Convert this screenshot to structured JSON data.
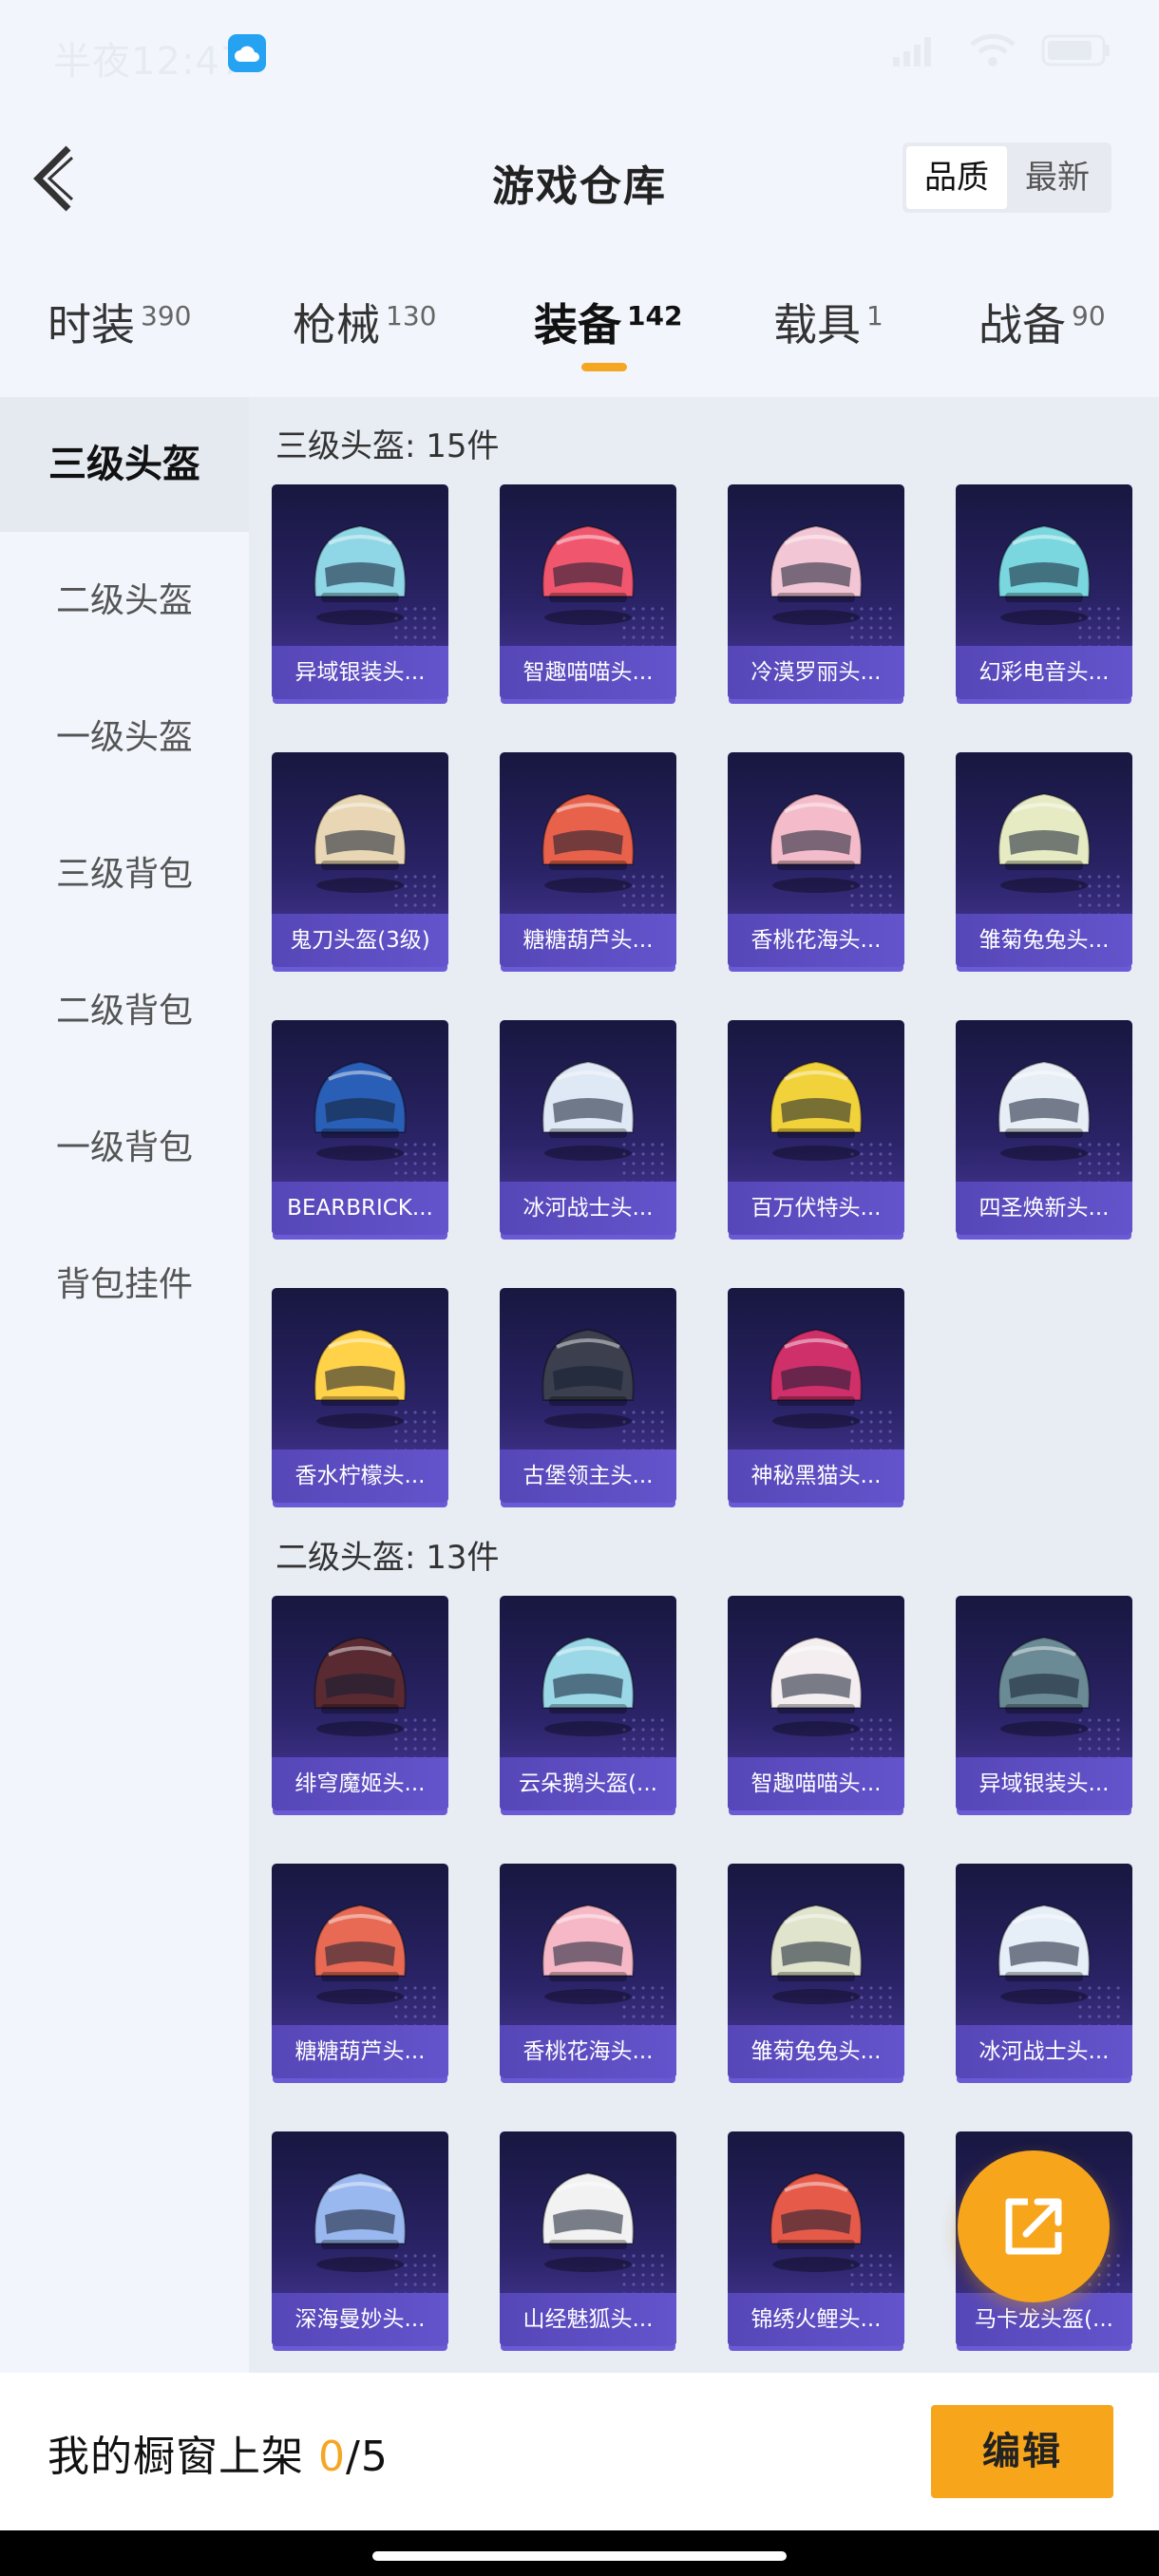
{
  "status_bar": {
    "time": "半夜12:47"
  },
  "header": {
    "title": "游戏仓库",
    "sort_options": [
      "品质",
      "最新"
    ]
  },
  "tabs": [
    {
      "label": "时装",
      "count": "390"
    },
    {
      "label": "枪械",
      "count": "130"
    },
    {
      "label": "装备",
      "count": "142"
    },
    {
      "label": "载具",
      "count": "1"
    },
    {
      "label": "战备",
      "count": "90"
    }
  ],
  "sidebar": [
    "三级头盔",
    "二级头盔",
    "一级头盔",
    "三级背包",
    "二级背包",
    "一级背包",
    "背包挂件"
  ],
  "sections": [
    {
      "title": "三级头盔: 15件",
      "items": [
        {
          "name": "异域银装头...",
          "color": "#8fd6e6"
        },
        {
          "name": "智趣喵喵头...",
          "color": "#f0566e"
        },
        {
          "name": "冷漠罗丽头...",
          "color": "#f3c6d6"
        },
        {
          "name": "幻彩电音头...",
          "color": "#7ad7e0"
        },
        {
          "name": "鬼刀头盔(3级)",
          "color": "#e8d6b4"
        },
        {
          "name": "糖糖葫芦头...",
          "color": "#e8614a"
        },
        {
          "name": "香桃花海头...",
          "color": "#f4bccb"
        },
        {
          "name": "雏菊兔兔头...",
          "color": "#e6ebc4"
        },
        {
          "name": "BEARBRICK...",
          "color": "#2a5fb8"
        },
        {
          "name": "冰河战士头...",
          "color": "#dfe8f5"
        },
        {
          "name": "百万伏特头...",
          "color": "#f2d23a"
        },
        {
          "name": "四圣焕新头...",
          "color": "#e8eef6"
        },
        {
          "name": "香水柠檬头...",
          "color": "#ffd24a"
        },
        {
          "name": "古堡领主头...",
          "color": "#3b3f4e"
        },
        {
          "name": "神秘黑猫头...",
          "color": "#d0306a"
        }
      ]
    },
    {
      "title": "二级头盔: 13件",
      "items": [
        {
          "name": "绯穹魔姬头...",
          "color": "#5a2a33"
        },
        {
          "name": "云朵鹅头盔(...",
          "color": "#9ad8e8"
        },
        {
          "name": "智趣喵喵头...",
          "color": "#f4eef0"
        },
        {
          "name": "异域银装头...",
          "color": "#6a8a96"
        },
        {
          "name": "糖糖葫芦头...",
          "color": "#e86a55"
        },
        {
          "name": "香桃花海头...",
          "color": "#f6b8c6"
        },
        {
          "name": "雏菊兔兔头...",
          "color": "#e0e4cc"
        },
        {
          "name": "冰河战士头...",
          "color": "#e6eef8"
        },
        {
          "name": "深海曼妙头...",
          "color": "#9ab8f0"
        },
        {
          "name": "山经魅狐头...",
          "color": "#f2f2f2"
        },
        {
          "name": "锦绣火鲤头...",
          "color": "#e65a4a"
        },
        {
          "name": "马卡龙头盔(...",
          "color": "#6fc8d0"
        }
      ]
    }
  ],
  "bottom_bar": {
    "label": "我的橱窗上架 ",
    "current": "0",
    "total": "/5",
    "edit_label": "编辑"
  },
  "accent_color": "#f7a51b"
}
